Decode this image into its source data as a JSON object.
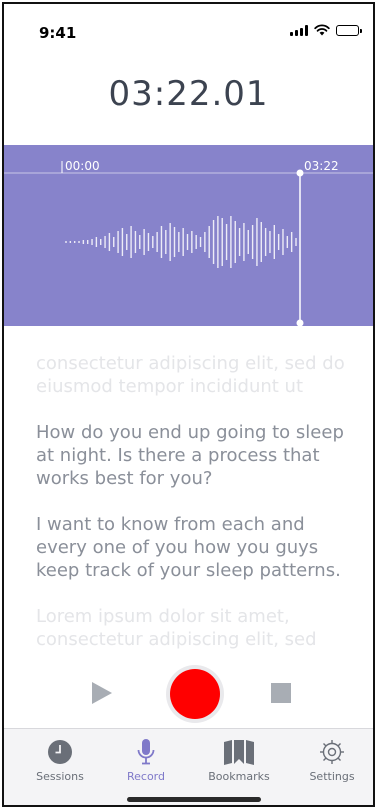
{
  "status_bar": {
    "time": "9:41"
  },
  "recorder": {
    "elapsed": "03:22.01",
    "timeline_start": "00:00",
    "timeline_end": "03:22",
    "waveform_color": "#8783cb",
    "playhead_position": 1.0
  },
  "transcript": {
    "paragraphs": [
      {
        "text": "consectetur adipiscing elit, sed do eiusmod tempor incididunt ut",
        "faded": true
      },
      {
        "text": "How do you end up going to sleep at night. Is there a process that works best for you?",
        "faded": false
      },
      {
        "text": "I want to know from each and every one of you how you guys keep track of your sleep patterns.",
        "faded": false
      },
      {
        "text": "Lorem ipsum dolor sit amet, consectetur adipiscing elit, sed",
        "faded": true
      }
    ]
  },
  "controls": {
    "play_icon": "play-icon",
    "record_icon": "record-icon",
    "stop_icon": "stop-icon",
    "record_color": "#ff0000"
  },
  "tabbar": {
    "active": "record",
    "accent_color": "#7f79c9",
    "items": [
      {
        "id": "sessions",
        "label": "Sessions",
        "icon": "clock-icon"
      },
      {
        "id": "record",
        "label": "Record",
        "icon": "microphone-icon"
      },
      {
        "id": "bookmarks",
        "label": "Bookmarks",
        "icon": "bookmarks-icon"
      },
      {
        "id": "settings",
        "label": "Settings",
        "icon": "gear-icon"
      }
    ]
  }
}
